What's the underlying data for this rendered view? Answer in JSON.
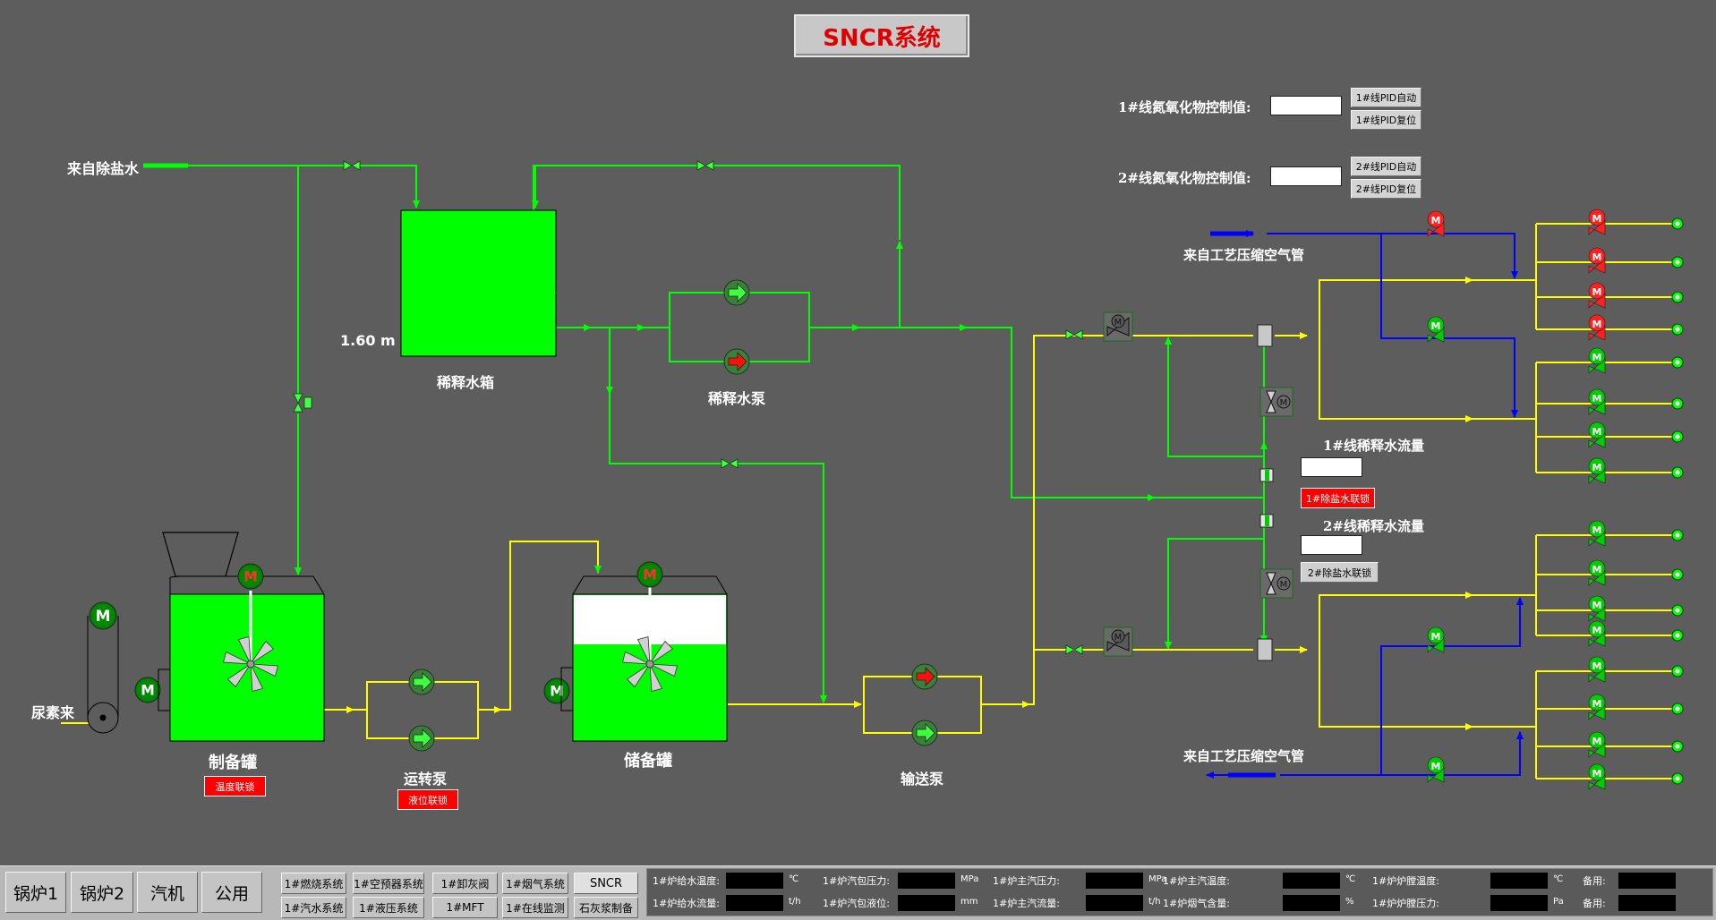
{
  "title": "SNCR系统",
  "labels": {
    "water_source": "来自除盐水",
    "urea_source": "尿素来",
    "dilution_tank": "稀释水箱",
    "tank_level": "1.60 m",
    "dilution_pump": "稀释水泵",
    "prep_tank": "制备罐",
    "transfer_pump": "运转泵",
    "storage_tank": "储备罐",
    "delivery_pump": "输送泵",
    "air_source_top": "来自工艺压缩空气管",
    "air_source_bottom": "来自工艺压缩空气管",
    "line1_nox": "1#线氮氧化物控制值:",
    "line2_nox": "2#线氮氧化物控制值:",
    "line1_flow": "1#线稀释水流量",
    "line2_flow": "2#线稀释水流量"
  },
  "buttons": {
    "line1_pid_auto": "1#线PID自动",
    "line1_pid_reset": "1#线PID复位",
    "line2_pid_auto": "2#线PID自动",
    "line2_pid_reset": "2#线PID复位",
    "desalt1_interlock": "1#除盐水联锁",
    "desalt2_interlock": "2#除盐水联锁",
    "temp_interlock": "温度联锁",
    "level_interlock": "液位联锁"
  },
  "nav": {
    "boiler1": "锅炉1",
    "boiler2": "锅炉2",
    "turbine": "汽机",
    "common": "公用",
    "combustion": "1#燃烧系统",
    "air_preheater": "1#空预器系统",
    "ash_valve": "1#卸灰阀",
    "flue_gas": "1#烟气系统",
    "sncr": "SNCR",
    "steam_water": "1#汽水系统",
    "hydraulic": "1#液压系统",
    "mft": "1#MFT",
    "online_monitor": "1#在线监测",
    "limestone": "石灰浆制备"
  },
  "status": {
    "row1": [
      {
        "label": "1#炉给水温度:",
        "unit": "℃"
      },
      {
        "label": "1#炉汽包压力:",
        "unit": "MPa"
      },
      {
        "label": "1#炉主汽压力:",
        "unit": "MPa"
      },
      {
        "label": "1#炉主汽温度:",
        "unit": "℃"
      },
      {
        "label": "1#炉炉膛温度:",
        "unit": "℃"
      },
      {
        "label": "备用:",
        "unit": ""
      }
    ],
    "row2": [
      {
        "label": "1#炉给水流量:",
        "unit": "t/h"
      },
      {
        "label": "1#炉汽包液位:",
        "unit": "mm"
      },
      {
        "label": "1#炉主汽流量:",
        "unit": "t/h"
      },
      {
        "label": "1#炉烟气含量:",
        "unit": "%"
      },
      {
        "label": "1#炉炉膛压力:",
        "unit": "Pa"
      },
      {
        "label": "备用:",
        "unit": ""
      }
    ]
  },
  "motor_letter": "M",
  "colors": {
    "water": "#00ff00",
    "solution": "#ffff00",
    "air": "#0000ff",
    "running": "#00c000",
    "stopped": "#e00000"
  },
  "pumps": {
    "dilution": [
      "running",
      "stopped"
    ],
    "transfer": [
      "running",
      "running"
    ],
    "delivery": [
      "stopped",
      "running"
    ]
  },
  "nozzle_valves_line1": [
    "stopped",
    "stopped",
    "stopped",
    "stopped",
    "running",
    "running",
    "running",
    "running"
  ],
  "nozzle_valves_line2": [
    "running",
    "running",
    "running",
    "running",
    "running",
    "running",
    "running",
    "running"
  ]
}
